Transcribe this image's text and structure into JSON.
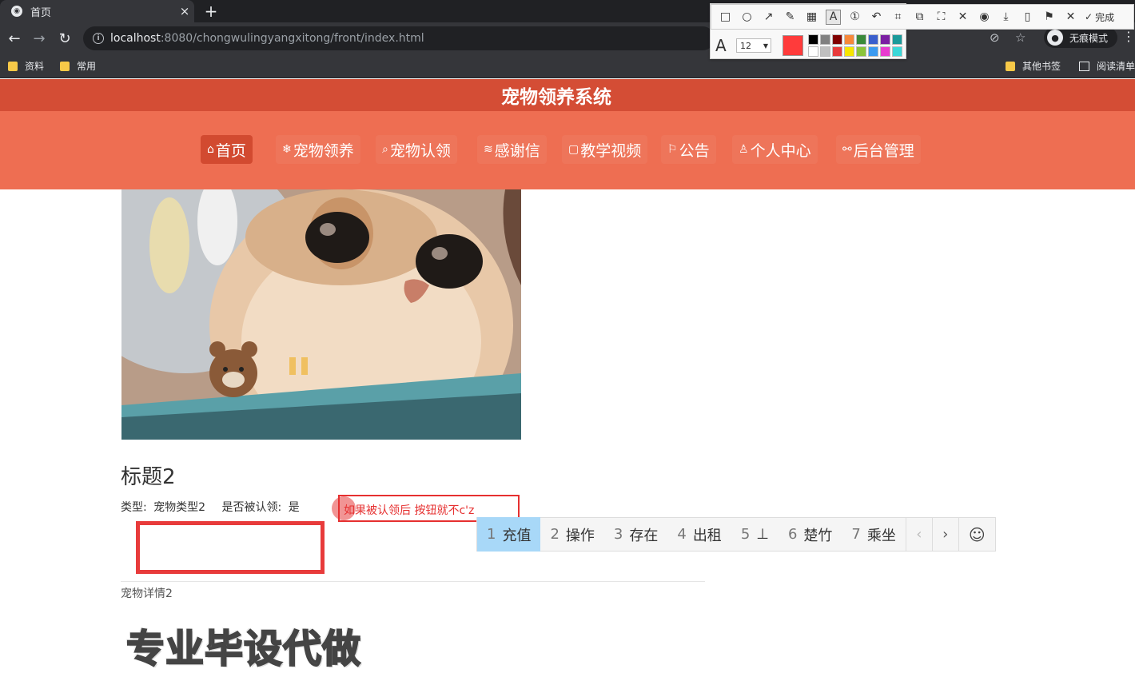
{
  "browser": {
    "tab_title": "首页",
    "new_tab": "+",
    "url_host": "localhost",
    "url_rest": ":8080/chongwulingyangxitong/front/index.html",
    "incognito_label": "无痕模式",
    "bookmarks": [
      {
        "label": "资料"
      },
      {
        "label": "常用"
      },
      {
        "label": "其他书签"
      },
      {
        "label": "阅读清单"
      }
    ]
  },
  "annotation_tool": {
    "done_label": "完成",
    "font_size": "12",
    "current_color": "#ff3b3b",
    "palette": [
      "#000000",
      "#808080",
      "#800000",
      "#f7883a",
      "#3a8a3a",
      "#3a5fcd",
      "#7a1fa2",
      "#1a9a9a",
      "#ffffff",
      "#c0c0c0",
      "#e83b3b",
      "#f7e600",
      "#8ac43a",
      "#3a9af0",
      "#e83bd0",
      "#3ad8d8"
    ]
  },
  "site": {
    "title": "宠物领养系统",
    "nav": [
      {
        "label": "首页",
        "icon": "⌂"
      },
      {
        "label": "宠物领养",
        "icon": "❄"
      },
      {
        "label": "宠物认领",
        "icon": "⌕"
      },
      {
        "label": "感谢信",
        "icon": "≋"
      },
      {
        "label": "教学视频",
        "icon": "▢"
      },
      {
        "label": "公告",
        "icon": "⚐"
      },
      {
        "label": "个人中心",
        "icon": "♙"
      },
      {
        "label": "后台管理",
        "icon": "⚯"
      }
    ]
  },
  "pet": {
    "title": "标题2",
    "type_label": "类型:",
    "type_value": "宠物类型2",
    "claimed_label": "是否被认领:",
    "claimed_value": "是",
    "detail": "宠物详情2",
    "watermark": "专业毕设代做"
  },
  "annotation_text": "如果被认领后 按钮就不c'z",
  "ime": {
    "candidates": [
      {
        "num": "1",
        "text": "充值"
      },
      {
        "num": "2",
        "text": "操作"
      },
      {
        "num": "3",
        "text": "存在"
      },
      {
        "num": "4",
        "text": "出租"
      },
      {
        "num": "5",
        "text": "⊥"
      },
      {
        "num": "6",
        "text": "楚竹"
      },
      {
        "num": "7",
        "text": "乘坐"
      }
    ],
    "prev": "‹",
    "next": "›",
    "emoji": "☺"
  }
}
